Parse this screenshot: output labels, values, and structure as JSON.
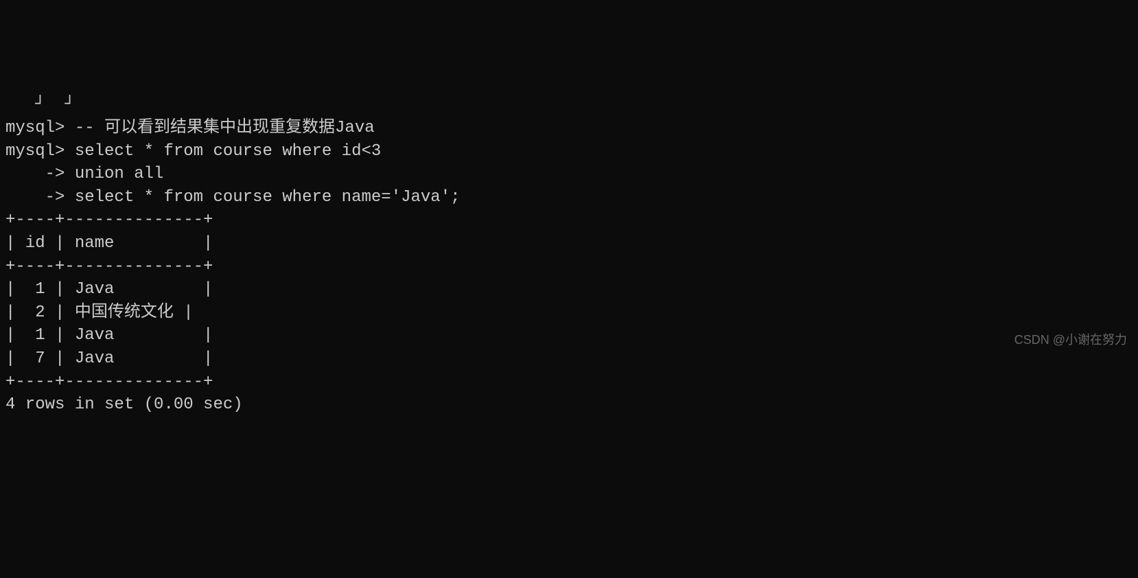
{
  "terminal": {
    "lines": [
      "mysql> -- 可以看到结果集中出现重复数据Java",
      "mysql> select * from course where id<3",
      "    -> union all",
      "    -> select * from course where name='Java';",
      "+----+--------------+",
      "| id | name         |",
      "+----+--------------+",
      "|  1 | Java         |",
      "|  2 | 中国传统文化 |",
      "|  1 | Java         |",
      "|  7 | Java         |",
      "+----+--------------+",
      "4 rows in set (0.00 sec)"
    ]
  },
  "watermark": "CSDN @小谢在努力",
  "query_data": {
    "prompt": "mysql>",
    "continuation": "    ->",
    "comment": "-- 可以看到结果集中出现重复数据Java",
    "sql_lines": [
      "select * from course where id<3",
      "union all",
      "select * from course where name='Java';"
    ],
    "result": {
      "columns": [
        "id",
        "name"
      ],
      "rows": [
        {
          "id": 1,
          "name": "Java"
        },
        {
          "id": 2,
          "name": "中国传统文化"
        },
        {
          "id": 1,
          "name": "Java"
        },
        {
          "id": 7,
          "name": "Java"
        }
      ],
      "row_count": 4,
      "time_sec": 0.0,
      "status": "4 rows in set (0.00 sec)"
    }
  }
}
